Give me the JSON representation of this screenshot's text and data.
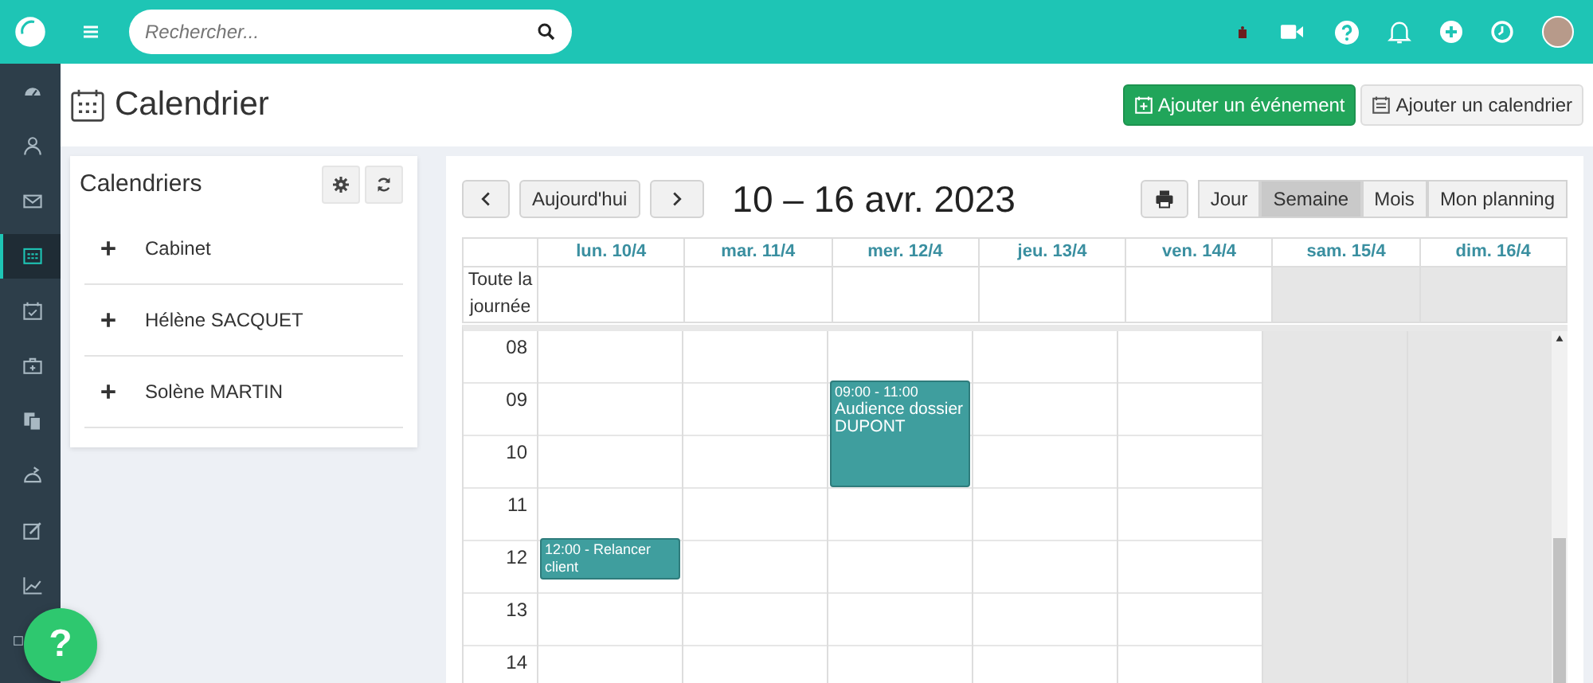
{
  "topbar": {
    "search": {
      "placeholder": "Rechercher..."
    }
  },
  "sidebar": {
    "items": [
      {
        "selected": false
      },
      {
        "selected": false
      },
      {
        "selected": false
      },
      {
        "selected": true
      },
      {
        "selected": false
      },
      {
        "selected": false
      },
      {
        "selected": false
      },
      {
        "selected": false
      },
      {
        "selected": false
      },
      {
        "selected": false
      },
      {
        "selected": false
      }
    ]
  },
  "page": {
    "title": "Calendrier",
    "buttons": [
      {
        "label": "Ajouter un événement",
        "kind": "primary"
      },
      {
        "label": "Ajouter un calendrier",
        "kind": "secondary"
      }
    ]
  },
  "calendars_panel": {
    "title": "Calendriers",
    "items": [
      {
        "label": "Cabinet"
      },
      {
        "label": "Hélène SACQUET"
      },
      {
        "label": "Solène MARTIN"
      }
    ]
  },
  "calendar": {
    "today": "Aujourd'hui",
    "range": "10 – 16 avr. 2023",
    "views": [
      {
        "label": "Jour",
        "selected": false
      },
      {
        "label": "Semaine",
        "selected": true
      },
      {
        "label": "Mois",
        "selected": false
      },
      {
        "label": "Mon planning",
        "selected": false
      }
    ],
    "all_day_label": "Toute la journée",
    "hours": [
      "08",
      "09",
      "10",
      "11",
      "12",
      "13",
      "14"
    ],
    "days": [
      {
        "label": "lun. 10/4",
        "weekend": false,
        "events": [
          {
            "time": "12:00 - Relancer client"
          }
        ]
      },
      {
        "label": "mar. 11/4",
        "weekend": false
      },
      {
        "label": "mer. 12/4",
        "weekend": false,
        "events": [
          {
            "time": "09:00 - 11:00",
            "title": "Audience dossier DUPONT"
          }
        ]
      },
      {
        "label": "jeu. 13/4",
        "weekend": false
      },
      {
        "label": "ven. 14/4",
        "weekend": false
      },
      {
        "label": "sam. 15/4",
        "weekend": true
      },
      {
        "label": "dim. 16/4",
        "weekend": true
      }
    ]
  },
  "help_button": {
    "label": "?"
  }
}
